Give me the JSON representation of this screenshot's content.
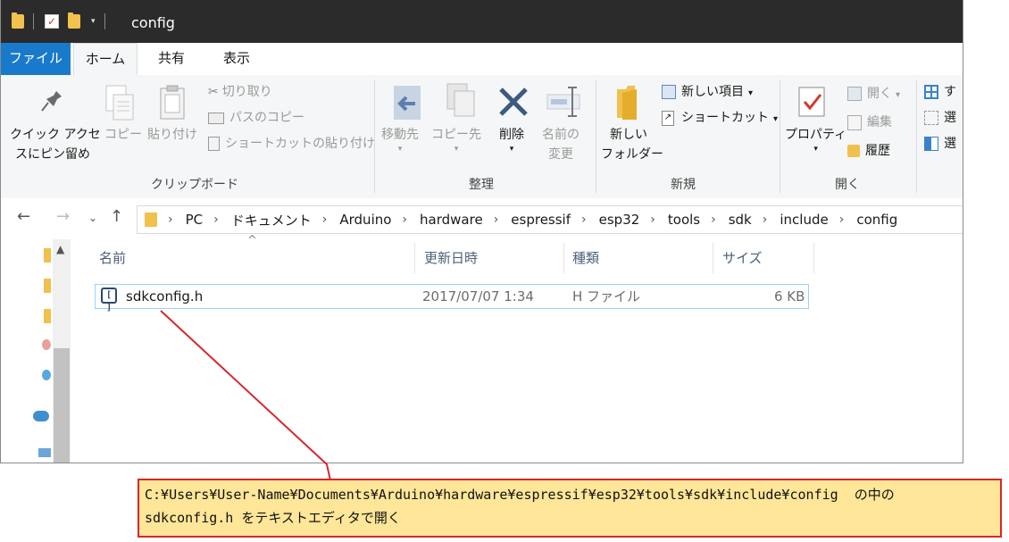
{
  "window": {
    "title": "config",
    "qa_toolbar_dropdown": "▾"
  },
  "ribbon_tabs": [
    "ファイル",
    "ホーム",
    "共有",
    "表示"
  ],
  "ribbon": {
    "clipboard": {
      "pin_label_line1": "クイック アクセ",
      "pin_label_line2": "スにピン留め",
      "copy": "コピー",
      "paste": "貼り付け",
      "cut": "切り取り",
      "copy_path": "パスのコピー",
      "paste_shortcut": "ショートカットの貼り付け",
      "group": "クリップボード"
    },
    "organize": {
      "move_to": "移動先",
      "copy_to": "コピー先",
      "delete": "削除",
      "rename_line1": "名前の",
      "rename_line2": "変更",
      "group": "整理"
    },
    "new": {
      "new_folder_line1": "新しい",
      "new_folder_line2": "フォルダー",
      "new_item": "新しい項目",
      "shortcut": "ショートカット",
      "group": "新規"
    },
    "open": {
      "properties": "プロパティ",
      "open": "開く",
      "edit": "編集",
      "history": "履歴",
      "group": "開く"
    },
    "select": {
      "select_all": "す",
      "select_none": "選",
      "invert": "選"
    }
  },
  "address": {
    "crumbs": [
      "PC",
      "ドキュメント",
      "Arduino",
      "hardware",
      "espressif",
      "esp32",
      "tools",
      "sdk",
      "include",
      "config"
    ]
  },
  "columns": [
    "名前",
    "更新日時",
    "種類",
    "サイズ"
  ],
  "files": [
    {
      "name": "sdkconfig.h",
      "modified": "2017/07/07 1:34",
      "type": "H ファイル",
      "size": "6 KB"
    }
  ],
  "callout": {
    "line1": "C:¥Users¥User-Name¥Documents¥Arduino¥hardware¥espressif¥esp32¥tools¥sdk¥include¥config  の中の",
    "line2": "sdkconfig.h をテキストエディタで開く"
  },
  "colors": {
    "titlebar": "#2b2b2b",
    "file_tab": "#1979ca",
    "selection_border": "#99d1ff",
    "callout_border": "#d8262b",
    "callout_fill": "#ffe699"
  }
}
